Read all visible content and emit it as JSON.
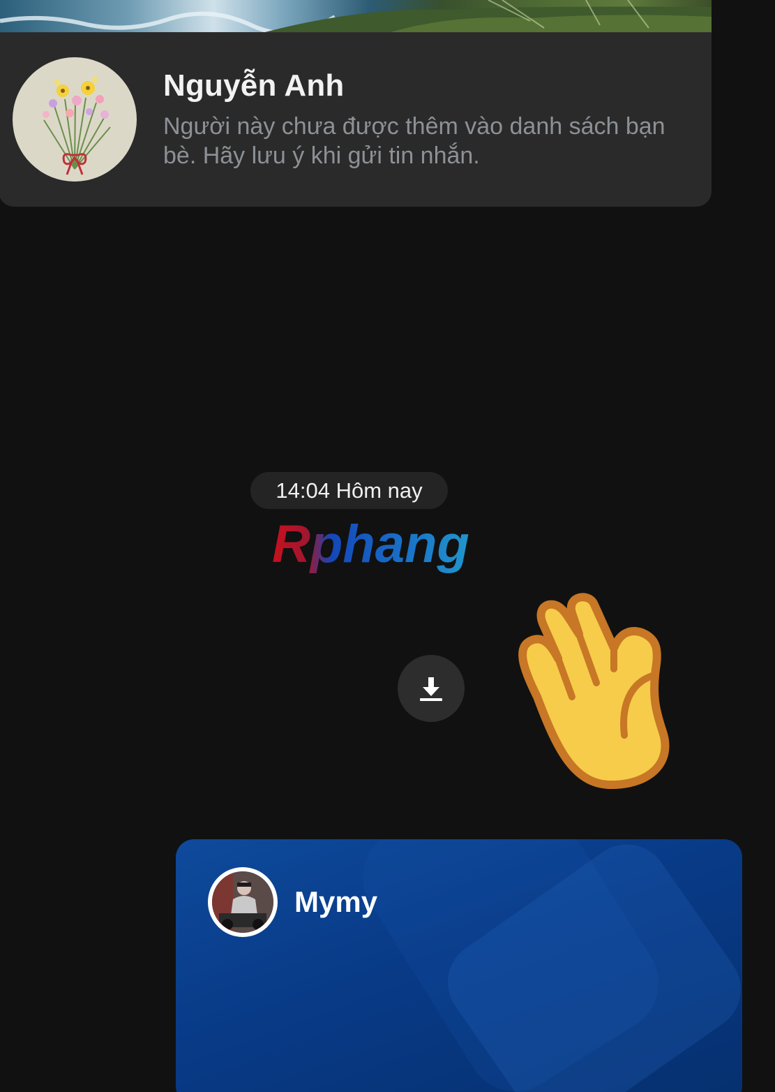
{
  "profile": {
    "name": "Nguyễn Anh",
    "note": "Người này chưa được thêm vào danh sách bạn bè. Hãy lưu ý khi gửi tin nhắn."
  },
  "chat": {
    "time_chip": "14:04 Hôm nay",
    "watermark": "Rphang",
    "download_icon": "download-icon",
    "sticker": "waving-hand"
  },
  "contact_card": {
    "name": "Mymy"
  },
  "colors": {
    "background": "#111111",
    "card": "#2a2a2a",
    "contact_card": "#083a86",
    "sticker_yellow": "#f6cc4a"
  }
}
